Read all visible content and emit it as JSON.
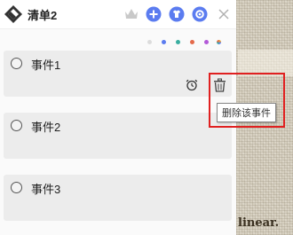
{
  "window": {
    "title": "清单2"
  },
  "toolbar": {
    "icons": [
      "crown-icon",
      "add-icon",
      "shirt-icon",
      "gear-icon",
      "close-icon"
    ],
    "accent_color": "#5b7cf0"
  },
  "color_dots": [
    "#dcdcdc",
    "#5b7cf0",
    "#3aaea0",
    "#e46a4a",
    "#b35ad8",
    "#e9a43a"
  ],
  "events": [
    {
      "label": "事件1"
    },
    {
      "label": "事件2"
    },
    {
      "label": "事件3"
    }
  ],
  "tooltip": {
    "text": "删除该事件"
  },
  "background_text": "linear."
}
